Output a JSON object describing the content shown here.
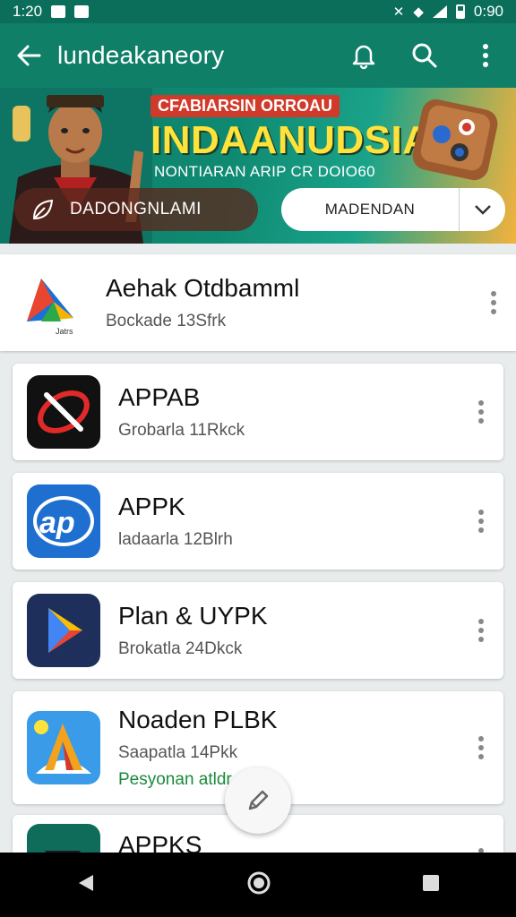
{
  "status_bar": {
    "time": "1:20",
    "clock_right": "0:90"
  },
  "app_bar": {
    "title": "lundeakaneory",
    "icons": [
      "back-arrow-icon",
      "bell-icon",
      "search-icon",
      "more-vert-icon"
    ]
  },
  "banner": {
    "tag": "CFABIARSIN ORROAU",
    "headline": "INDAANUDSIA",
    "subline": "NONTIARAN ARIP CR DOIO60",
    "primary_button": "DADONGNLAMI",
    "secondary_button": "MADENDAN"
  },
  "apps": [
    {
      "name": "Aehak Otdbamml",
      "size": "Bockade 13Sfrk",
      "icon": "play-triangle-icon"
    },
    {
      "name": "APPAB",
      "size": "Grobarla 11Rkck",
      "icon": "red-x-icon"
    },
    {
      "name": "APPK",
      "size": "ladaarla 12Blrh",
      "icon": "ad-badge-icon"
    },
    {
      "name": "Plan & UYPK",
      "size": "Brokatla 24Dkck",
      "icon": "play-store-icon"
    },
    {
      "name": "Noaden PLBK",
      "size": "Saapatla 14Pkk",
      "extra": "Pesyonan atldr",
      "icon": "letter-a-icon"
    },
    {
      "name": "APPKS",
      "icon": "partial-app-icon"
    }
  ],
  "colors": {
    "primary": "#0f7f68",
    "status": "#0b6e5b",
    "accent_yellow": "#ffe23a",
    "installed_green": "#1a8a3a"
  },
  "fab": {
    "icon": "pencil-icon"
  },
  "nav": {
    "icons": [
      "nav-back-icon",
      "nav-home-icon",
      "nav-recents-icon"
    ]
  }
}
